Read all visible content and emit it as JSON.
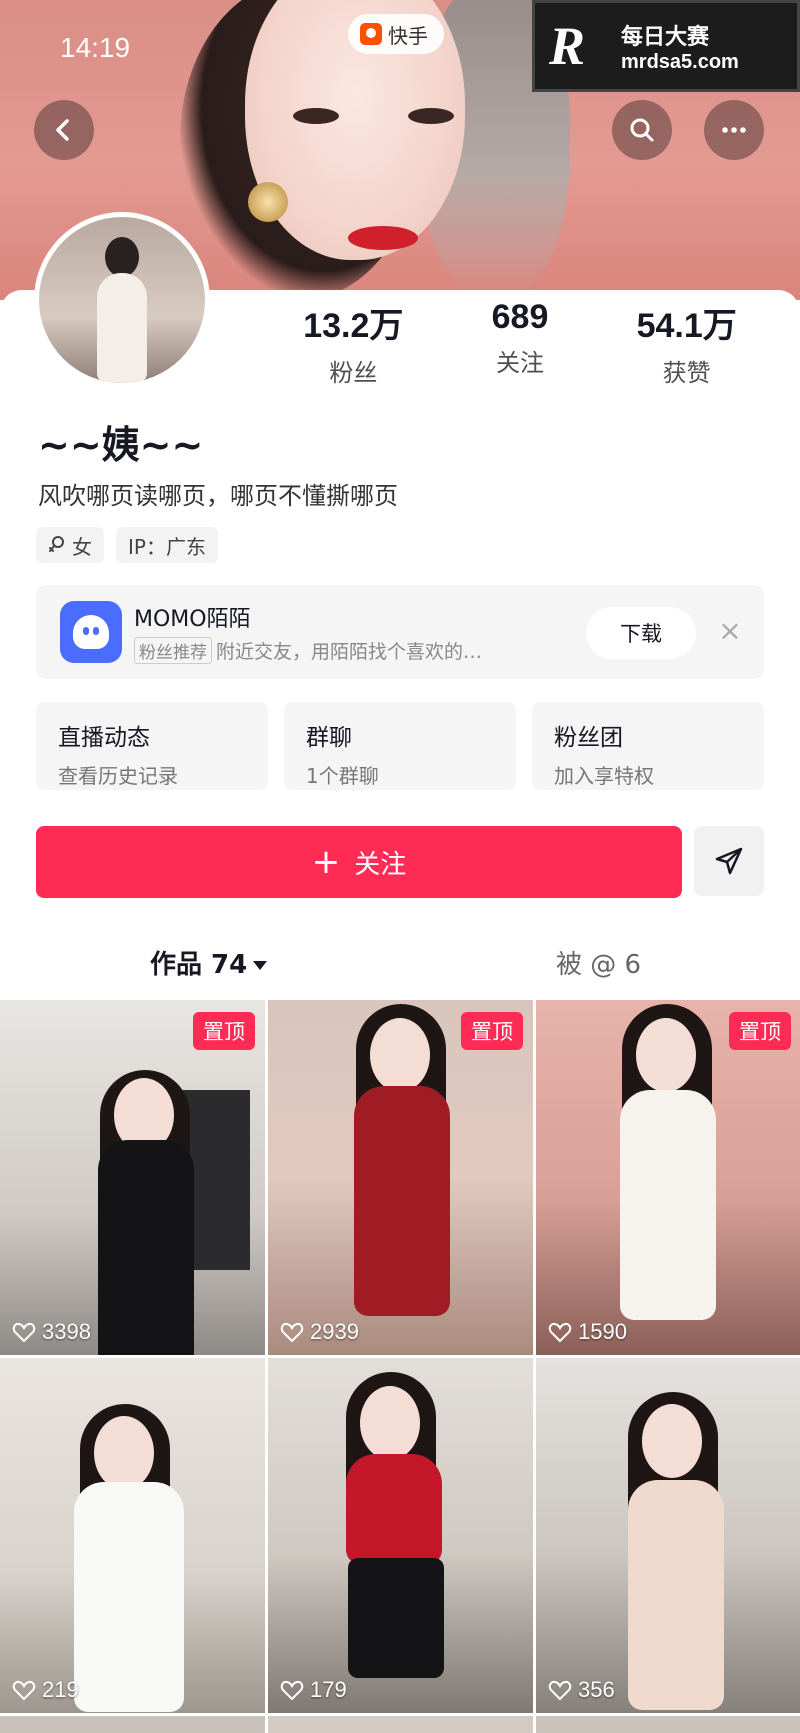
{
  "status_bar": {
    "time": "14:19"
  },
  "app_pill": {
    "label": "快手"
  },
  "watermark": {
    "letter": "R",
    "cn": "每日大赛",
    "url": "mrdsa5.com"
  },
  "profile": {
    "nickname": "~~姨~~",
    "bio": "风吹哪页读哪页，哪页不懂撕哪页",
    "tags": [
      {
        "icon": "female-icon",
        "label": "女"
      },
      {
        "icon": "",
        "label": "IP：广东"
      }
    ],
    "stats": [
      {
        "value": "13.2万",
        "label": "粉丝"
      },
      {
        "value": "689",
        "label": "关注"
      },
      {
        "value": "54.1万",
        "label": "获赞"
      }
    ]
  },
  "ad": {
    "title": "MOMO陌陌",
    "badge": "粉丝推荐",
    "subtitle": "附近交友，用陌陌找个喜欢的…",
    "button": "下载",
    "close": "×"
  },
  "features": [
    {
      "title": "直播动态",
      "subtitle": "查看历史记录"
    },
    {
      "title": "群聊",
      "subtitle": "1个群聊"
    },
    {
      "title": "粉丝团",
      "subtitle": "加入享特权"
    }
  ],
  "actions": {
    "follow_plus": "+",
    "follow": "关注"
  },
  "tabs": {
    "works": "作品 74",
    "mentions": "被 @ 6"
  },
  "grid": [
    {
      "likes": "3398",
      "pinned": "置顶"
    },
    {
      "likes": "2939",
      "pinned": "置顶"
    },
    {
      "likes": "1590",
      "pinned": "置顶"
    },
    {
      "likes": "219",
      "pinned": ""
    },
    {
      "likes": "179",
      "pinned": ""
    },
    {
      "likes": "356",
      "pinned": ""
    }
  ],
  "colors": {
    "accent": "#fe2c55",
    "ad_icon": "#4a6dff"
  }
}
